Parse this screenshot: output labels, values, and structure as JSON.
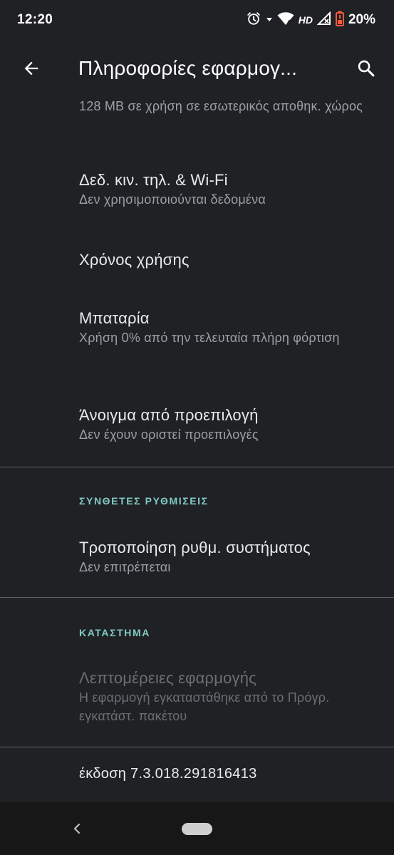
{
  "status_bar": {
    "time": "12:20",
    "network_label": "HD",
    "battery": "20%",
    "icons": [
      "alarm-icon",
      "wifi-icon",
      "signal-icon",
      "battery-icon"
    ]
  },
  "app_bar": {
    "title": "Πληροφορίες εφαρμογ...",
    "back_icon": "arrow-back-icon",
    "search_icon": "search-icon"
  },
  "items": [
    {
      "title": "",
      "subtitle": "128 MB σε χρήση σε εσωτερικός αποθηκ. χώρος"
    },
    {
      "title": "Δεδ. κιν. τηλ. & Wi-Fi",
      "subtitle": "Δεν χρησιμοποιούνται δεδομένα"
    },
    {
      "title": "Χρόνος χρήσης",
      "subtitle": ""
    },
    {
      "title": "Μπαταρία",
      "subtitle": "Χρήση 0% από την τελευταία πλήρη φόρτιση"
    },
    {
      "title": "Άνοιγμα από προεπιλογή",
      "subtitle": "Δεν έχουν οριστεί προεπιλογές"
    }
  ],
  "advanced": {
    "header": "ΣΥΝΘΕΤΕΣ ΡΥΘΜΙΣΕΙΣ",
    "items": [
      {
        "title": "Τροποποίηση ρυθμ. συστήματος",
        "subtitle": "Δεν επιτρέπεται"
      }
    ]
  },
  "store": {
    "header": "ΚΑΤΑΣΤΗΜΑ",
    "items": [
      {
        "title": "Λεπτομέρειες εφαρμογής",
        "subtitle": "Η εφαρμογή εγκαταστάθηκε από το Πρόγρ. εγκατάστ. πακέτου"
      }
    ]
  },
  "version": "έκδοση 7.3.018.291816413",
  "colors": {
    "background": "#202124",
    "accent": "#80cbc4",
    "divider": "#5f6368",
    "nav_bar": "#171717"
  }
}
